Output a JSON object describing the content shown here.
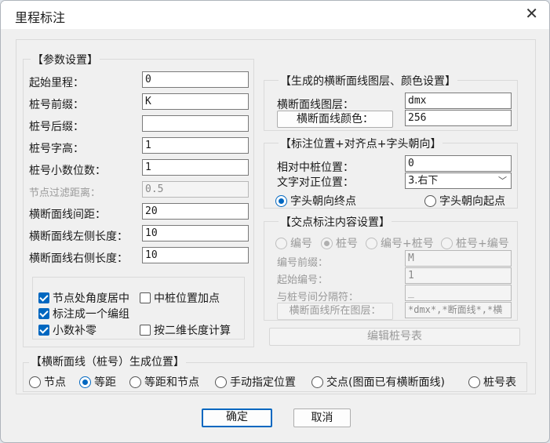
{
  "window": {
    "title": "里程标注"
  },
  "params": {
    "title": "【参数设置】",
    "start_mileage": {
      "label": "起始里程：",
      "value": "0"
    },
    "pile_prefix": {
      "label": "桩号前缀：",
      "value": "K"
    },
    "pile_suffix": {
      "label": "桩号后缀：",
      "value": ""
    },
    "pile_text_height": {
      "label": "桩号字高：",
      "value": "1"
    },
    "pile_decimals": {
      "label": "桩号小数位数：",
      "value": "1"
    },
    "node_filter": {
      "label": "节点过滤距离：",
      "value": "0.5"
    },
    "section_spacing": {
      "label": "横断面线间距：",
      "value": "20"
    },
    "left_length": {
      "label": "横断面线左侧长度：",
      "value": "10"
    },
    "right_length": {
      "label": "横断面线右侧长度：",
      "value": "10"
    }
  },
  "options": {
    "node_center": "节点处角度居中",
    "middle_pile_add": "中桩位置加点",
    "one_group": "标注成一个编组",
    "decimal_pad": "小数补零",
    "calc_2d": "按二维长度计算"
  },
  "layer": {
    "title": "【生成的横断面线图层、颜色设置】",
    "layer_label": "横断面线图层：",
    "layer_value": "dmx",
    "color_button": "横断面线颜色：",
    "color_value": "256"
  },
  "position": {
    "title": "【标注位置+对齐点+字头朝向】",
    "relative_label": "相对中桩位置：",
    "relative_value": "0",
    "align_label": "文字对正位置：",
    "align_value": "3.右下",
    "head_end": "字头朝向终点",
    "head_start": "字头朝向起点"
  },
  "intersection": {
    "title": "【交点标注内容设置】",
    "opt_number": "编号",
    "opt_pile": "桩号",
    "opt_number_pile": "编号+桩号",
    "opt_pile_number": "桩号+编号",
    "number_prefix_label": "编号前缀：",
    "number_prefix_value": "M",
    "start_number_label": "起始编号：",
    "start_number_value": "1",
    "separator_label": "与桩号间分隔符：",
    "separator_value": "_",
    "layer_button": "横断面线所在图层：",
    "layer_value": "*dmx*,*断面线*,*横"
  },
  "edit_button": "编辑桩号表",
  "generate": {
    "title": "【横断面线（桩号）生成位置】",
    "node": "节点",
    "equal": "等距",
    "equal_node": "等距和节点",
    "manual": "手动指定位置",
    "cross": "交点(图面已有横断面线)",
    "pile_table": "桩号表"
  },
  "footer": {
    "ok": "确定",
    "cancel": "取消"
  }
}
